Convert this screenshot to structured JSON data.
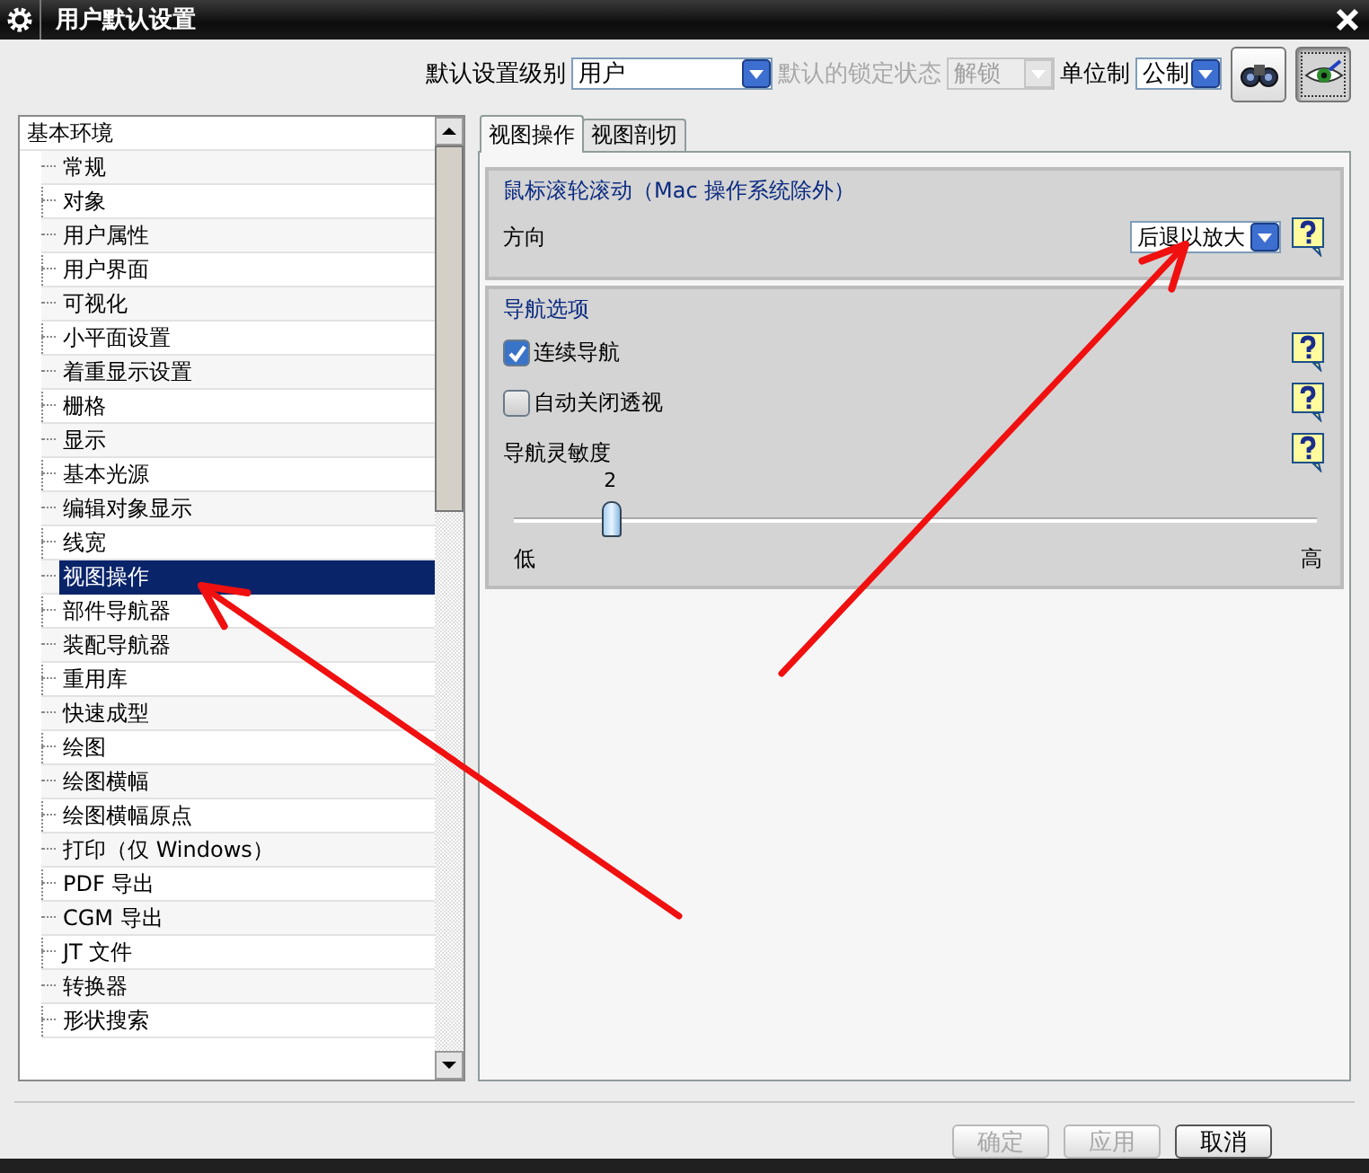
{
  "window": {
    "title": "用户默认设置"
  },
  "toolbar": {
    "level_label": "默认设置级别",
    "level_value": "用户",
    "lock_label": "默认的锁定状态",
    "lock_value": "解锁",
    "lock_disabled": true,
    "units_label": "单位制",
    "units_value": "公制",
    "tools": [
      {
        "kind": "binoculars",
        "selected": false
      },
      {
        "kind": "eye",
        "selected": true
      }
    ]
  },
  "tree": {
    "label": "基本环境",
    "children": [
      {
        "label": "常规",
        "selected": false
      },
      {
        "label": "对象",
        "selected": false
      },
      {
        "label": "用户属性",
        "selected": false
      },
      {
        "label": "用户界面",
        "selected": false
      },
      {
        "label": "可视化",
        "selected": false
      },
      {
        "label": "小平面设置",
        "selected": false
      },
      {
        "label": "着重显示设置",
        "selected": false
      },
      {
        "label": "栅格",
        "selected": false
      },
      {
        "label": "显示",
        "selected": false
      },
      {
        "label": "基本光源",
        "selected": false
      },
      {
        "label": "编辑对象显示",
        "selected": false
      },
      {
        "label": "线宽",
        "selected": false
      },
      {
        "label": "视图操作",
        "selected": true
      },
      {
        "label": "部件导航器",
        "selected": false
      },
      {
        "label": "装配导航器",
        "selected": false
      },
      {
        "label": "重用库",
        "selected": false
      },
      {
        "label": "快速成型",
        "selected": false
      },
      {
        "label": "绘图",
        "selected": false
      },
      {
        "label": "绘图横幅",
        "selected": false
      },
      {
        "label": "绘图横幅原点",
        "selected": false
      },
      {
        "label": "打印（仅 Windows）",
        "selected": false
      },
      {
        "label": "PDF 导出",
        "selected": false
      },
      {
        "label": "CGM 导出",
        "selected": false
      },
      {
        "label": "JT 文件",
        "selected": false
      },
      {
        "label": "转换器",
        "selected": false
      },
      {
        "label": "形状搜索",
        "selected": false
      }
    ]
  },
  "tabs": [
    {
      "label": "视图操作",
      "selected": true
    },
    {
      "label": "视图剖切",
      "selected": false
    }
  ],
  "groups": [
    {
      "title": "鼠标滚轮滚动（Mac 操作系统除外）",
      "rows": [
        {
          "kind": "dropdown",
          "label": "方向",
          "value": "后退以放大"
        }
      ]
    },
    {
      "title": "导航选项",
      "rows": [
        {
          "kind": "checkbox",
          "label": "连续导航",
          "checked": true
        },
        {
          "kind": "checkbox",
          "label": "自动关闭透视",
          "checked": false
        },
        {
          "kind": "slider",
          "label": "导航灵敏度",
          "reading": "2",
          "level": 0.12,
          "min_label": "低",
          "max_label": "高"
        }
      ]
    }
  ],
  "buttons": [
    {
      "label": "确定",
      "disabled": true
    },
    {
      "label": "应用",
      "disabled": true
    },
    {
      "label": "取消",
      "disabled": false
    }
  ],
  "annotations": [
    {
      "kind": "arrow"
    },
    {
      "kind": "arrow"
    }
  ]
}
